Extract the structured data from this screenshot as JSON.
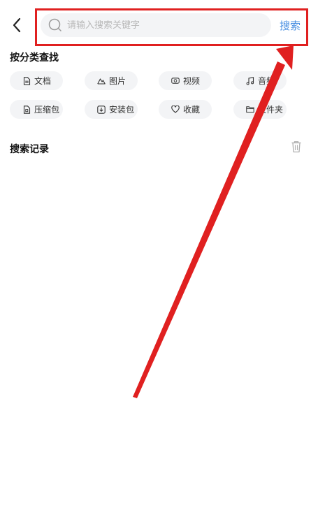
{
  "header": {
    "back_label": "",
    "search_placeholder": "请输入搜索关键字",
    "search_value": "",
    "search_action": "搜索"
  },
  "categories": {
    "title": "按分类查找",
    "items": [
      {
        "label": "文档",
        "icon": "document-icon"
      },
      {
        "label": "图片",
        "icon": "image-icon"
      },
      {
        "label": "视频",
        "icon": "video-icon"
      },
      {
        "label": "音频",
        "icon": "music-icon"
      },
      {
        "label": "压缩包",
        "icon": "archive-icon"
      },
      {
        "label": "安装包",
        "icon": "download-icon"
      },
      {
        "label": "收藏",
        "icon": "heart-icon"
      },
      {
        "label": "文件夹",
        "icon": "folder-icon"
      }
    ]
  },
  "history": {
    "title": "搜索记录"
  },
  "colors": {
    "accent": "#4a90e2",
    "chip_bg": "#f3f4f6",
    "annotation": "#e02020"
  }
}
